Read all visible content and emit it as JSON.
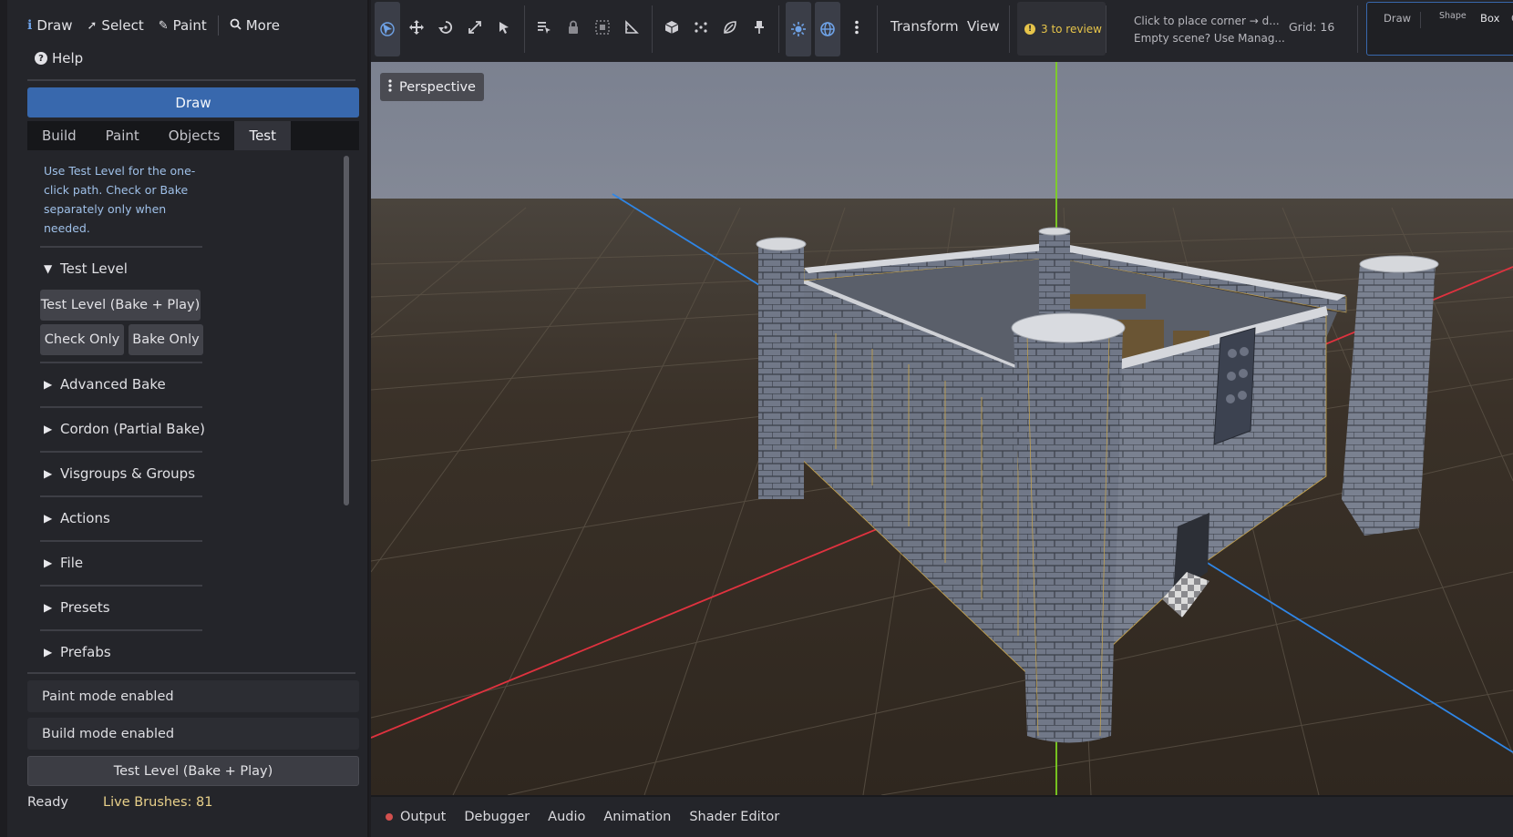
{
  "menu": {
    "draw": "Draw",
    "select": "Select",
    "paint": "Paint",
    "more": "More",
    "help": "Help"
  },
  "dock": {
    "mode_button": "Draw",
    "tabs": [
      "Build",
      "Paint",
      "Objects",
      "Test"
    ],
    "active_tab": "Test",
    "hint": "Use Test Level for the one-click path. Check or Bake separately only when needed.",
    "test_section": "Test Level",
    "test_level_button": "Test Level  (Bake + Play)",
    "check_only_button": "Check Only",
    "bake_only_button": "Bake Only",
    "sections": [
      "Advanced Bake",
      "Cordon (Partial Bake)",
      "Visgroups & Groups",
      "Actions",
      "File",
      "Presets",
      "Prefabs"
    ],
    "paint_status": "Paint mode enabled",
    "build_status": "Build mode enabled",
    "bottom_test_button": "Test Level  (Bake + Play)",
    "ready": "Ready",
    "live_brushes": "Live Brushes: 81"
  },
  "toolbar": {
    "transform": "Transform",
    "view": "View",
    "review": "3 to review",
    "notice_line1": "Click to place corner → d...",
    "notice_line2": "Empty scene? Use Manag...",
    "grid": "Grid: 16",
    "mini_draw": "Draw",
    "mini_shape": "Shape",
    "mini_box": "Box",
    "mini_c": "C"
  },
  "viewport": {
    "perspective": "Perspective"
  },
  "bottom": {
    "tabs": [
      "Output",
      "Debugger",
      "Audio",
      "Animation",
      "Shader Editor"
    ]
  },
  "colors": {
    "accent": "#3868ad",
    "warning": "#e6c44a",
    "hint": "#9fc0e8",
    "x_axis": "#e0323f",
    "y_axis": "#7ed321",
    "z_axis": "#2f86e6"
  }
}
